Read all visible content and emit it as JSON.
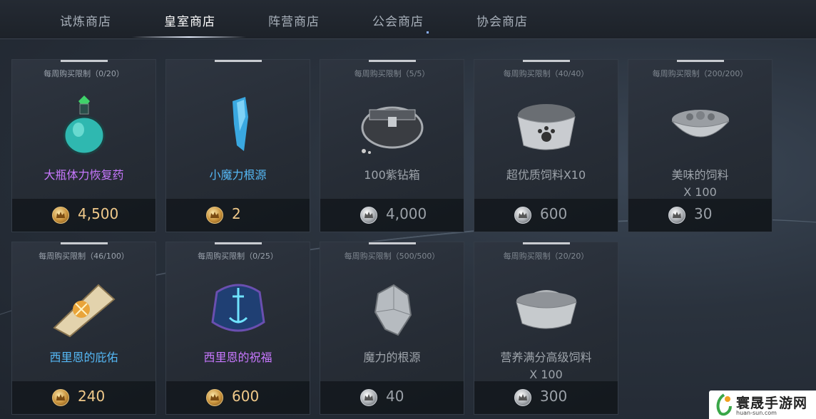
{
  "tabs": [
    {
      "label": "试炼商店",
      "active": false
    },
    {
      "label": "皇室商店",
      "active": true
    },
    {
      "label": "阵营商店",
      "active": false
    },
    {
      "label": "公会商店",
      "active": false
    },
    {
      "label": "协会商店",
      "active": false
    }
  ],
  "items": [
    {
      "limit": "每周购买限制（0/20）",
      "name": "大瓶体力恢复药",
      "name_color": "purple",
      "currency": "gold",
      "price": "4,500",
      "icon": "potion-icon"
    },
    {
      "limit": "",
      "name": "小魔力根源",
      "name_color": "blue",
      "currency": "gold",
      "price": "2",
      "icon": "crystal-icon"
    },
    {
      "limit": "每周购买限制（5/5）",
      "name": "100紫钻箱",
      "name_color": "gray",
      "currency": "silver",
      "price": "4,000",
      "icon": "chest-icon"
    },
    {
      "limit": "每周购买限制（40/40）",
      "name": "超优质饲料X10",
      "name_color": "gray",
      "currency": "silver",
      "price": "600",
      "icon": "pet-food-bowl-icon"
    },
    {
      "limit": "每周购买限制（200/200）",
      "name": "美味的饲料",
      "name_line2": "X 100",
      "name_color": "gray",
      "currency": "silver",
      "price": "30",
      "icon": "food-bowl-icon"
    },
    {
      "limit": "每周购买限制（46/100）",
      "name": "西里恩的庇佑",
      "name_color": "blue",
      "currency": "gold",
      "price": "240",
      "icon": "scroll-icon"
    },
    {
      "limit": "每周购买限制（0/25）",
      "name": "西里恩的祝福",
      "name_color": "purple",
      "currency": "gold",
      "price": "600",
      "icon": "rune-stone-icon"
    },
    {
      "limit": "每周购买限制（500/500）",
      "name": "魔力的根源",
      "name_color": "gray",
      "currency": "silver",
      "price": "40",
      "icon": "ore-icon"
    },
    {
      "limit": "每周购买限制（20/20）",
      "name": "营养满分高级饲料",
      "name_line2": "X 100",
      "name_color": "gray",
      "currency": "silver",
      "price": "300",
      "icon": "premium-food-bowl-icon"
    }
  ],
  "watermark": {
    "text": "寰晟手游网",
    "url": "huan-sun.com"
  }
}
